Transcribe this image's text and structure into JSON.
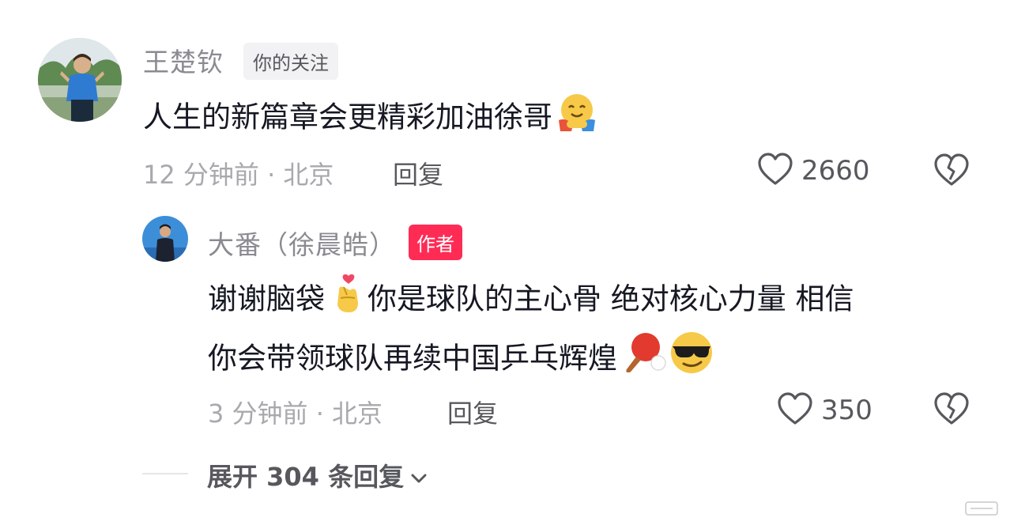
{
  "comment": {
    "username": "王楚钦",
    "follow_tag": "你的关注",
    "text": "人生的新篇章会更精彩加油徐哥",
    "emoji": "hugging-face-emoji",
    "time": "12 分钟前 · 北京",
    "reply_label": "回复",
    "likes": "2660"
  },
  "reply": {
    "username": "大番（徐晨皓）",
    "author_tag": "作者",
    "text_line1_a": "谢谢脑袋",
    "text_line1_b": "你是球队的主心骨 绝对核心力量 相信",
    "text_line2": "你会带领球队再续中国乒乓辉煌",
    "emojis": [
      "finger-heart-emoji",
      "ping-pong-emoji",
      "sunglasses-emoji"
    ],
    "time": "3 分钟前 · 北京",
    "reply_label": "回复",
    "likes": "350"
  },
  "expand": {
    "label": "展开 304 条回复"
  },
  "colors": {
    "author_tag": "#fe2c55",
    "username": "#8a8b91",
    "meta": "#a8a9ad"
  }
}
